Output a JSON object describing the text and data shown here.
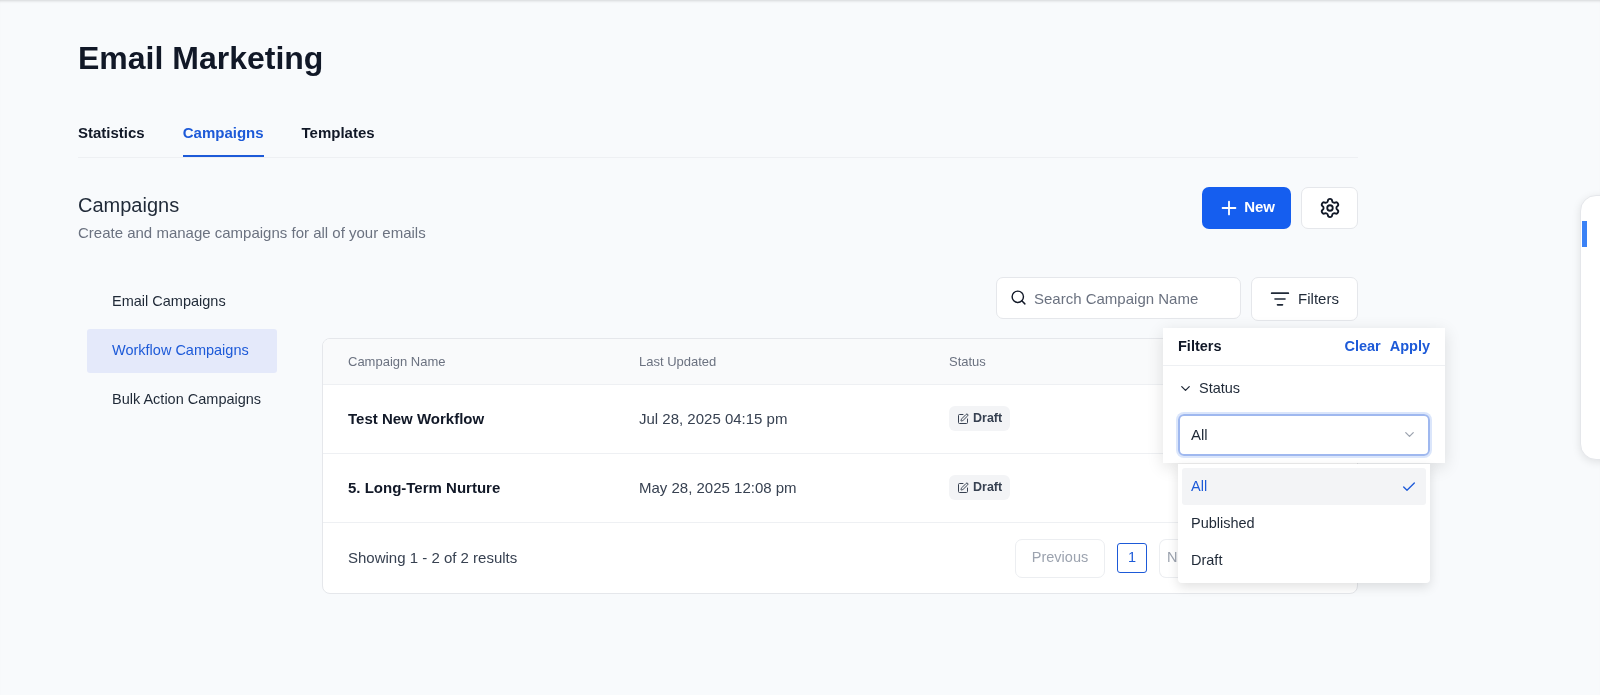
{
  "page_title": "Email Marketing",
  "tabs": [
    {
      "label": "Statistics",
      "selected": false
    },
    {
      "label": "Campaigns",
      "selected": true
    },
    {
      "label": "Templates",
      "selected": false
    }
  ],
  "section": {
    "title": "Campaigns",
    "subtitle": "Create and manage campaigns for all of your emails",
    "new_button": "New"
  },
  "sidebar": {
    "items": [
      {
        "label": "Email Campaigns",
        "selected": false
      },
      {
        "label": "Workflow Campaigns",
        "selected": true
      },
      {
        "label": "Bulk Action Campaigns",
        "selected": false
      }
    ]
  },
  "search": {
    "placeholder": "Search Campaign Name"
  },
  "filters_button": "Filters",
  "table": {
    "columns": [
      "Campaign Name",
      "Last Updated",
      "Status"
    ],
    "rows": [
      {
        "name": "Test New Workflow",
        "updated": "Jul 28, 2025 04:15 pm",
        "status": "Draft"
      },
      {
        "name": "5. Long-Term Nurture",
        "updated": "May 28, 2025 12:08 pm",
        "status": "Draft"
      }
    ],
    "summary": "Showing 1 - 2 of 2 results",
    "pagination": {
      "previous": "Previous",
      "pages": [
        {
          "label": "1",
          "selected": true
        }
      ],
      "next": "N"
    }
  },
  "filter_panel": {
    "title": "Filters",
    "clear": "Clear",
    "apply": "Apply",
    "group": {
      "label": "Status",
      "expanded": true
    },
    "select_value": "All",
    "options": [
      {
        "label": "All",
        "selected": true
      },
      {
        "label": "Published",
        "selected": false
      },
      {
        "label": "Draft",
        "selected": false
      }
    ]
  }
}
